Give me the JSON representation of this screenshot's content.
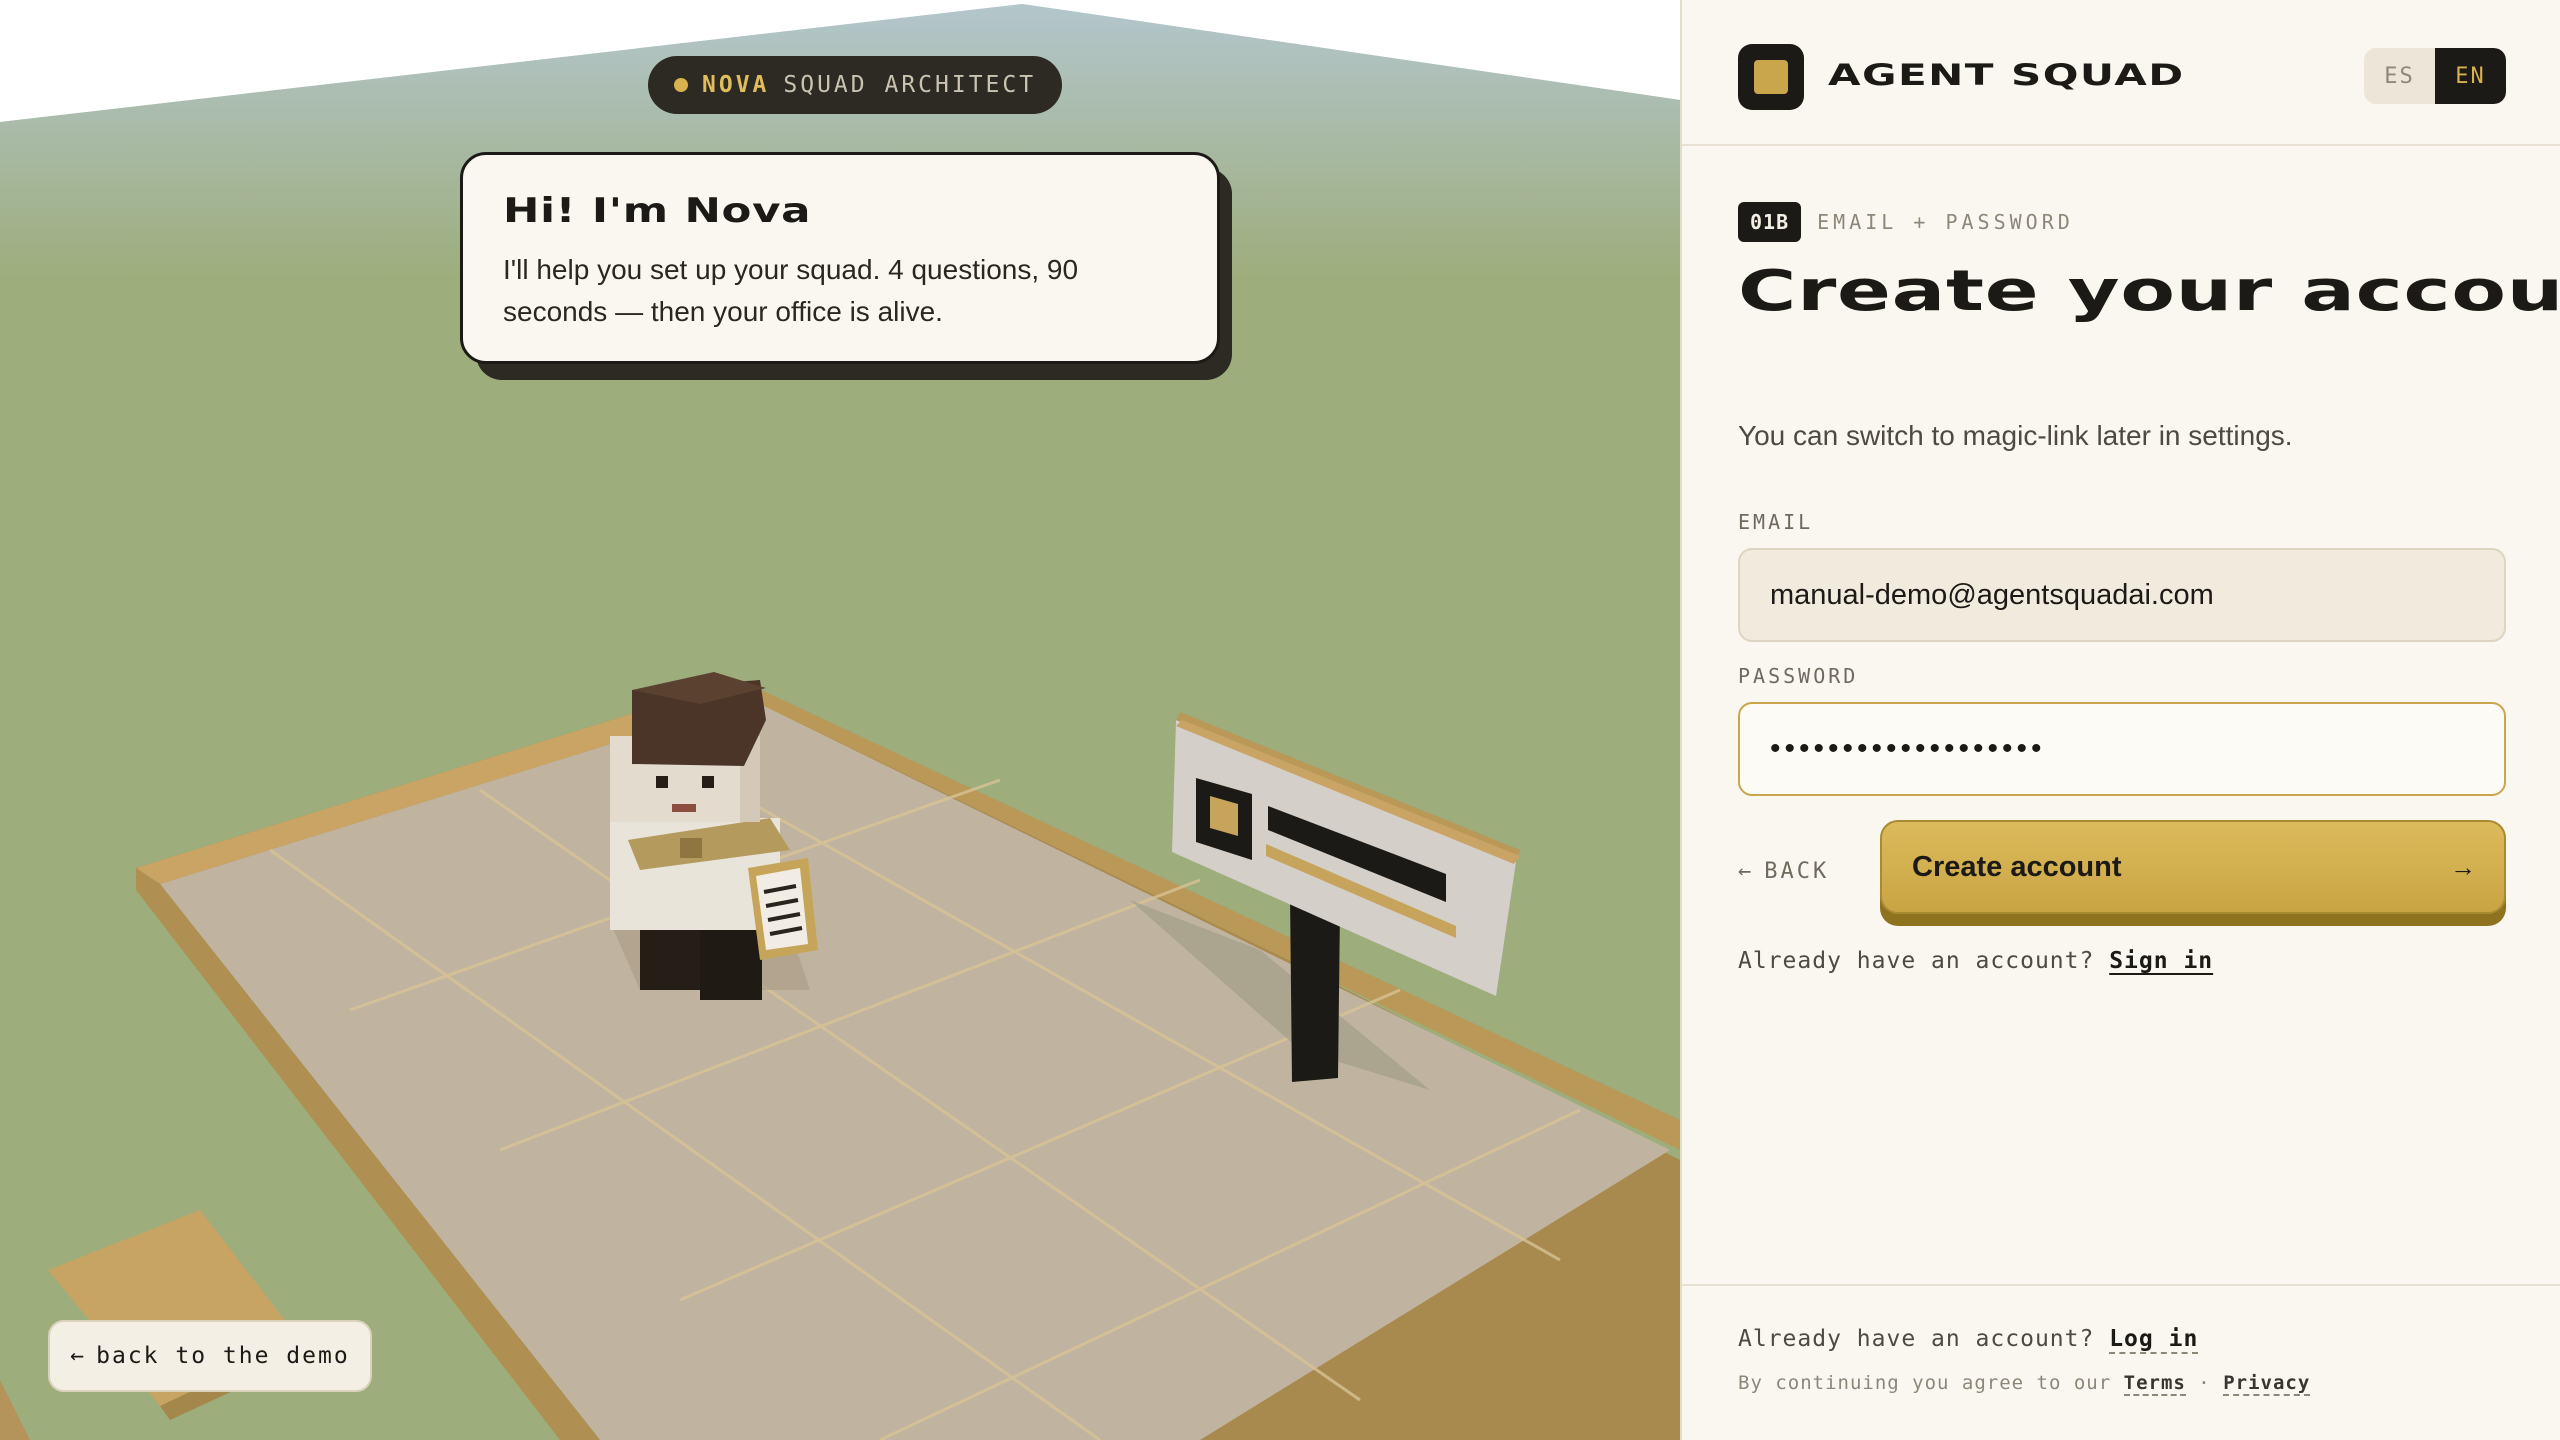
{
  "scene": {
    "badge": {
      "name": "NOVA",
      "role": "SQUAD ARCHITECT"
    },
    "bubble": {
      "title": "Hi! I'm Nova",
      "text": "I'll help you set up your squad. 4 questions, 90 seconds — then your office is alive."
    },
    "back_demo": {
      "arrow": "←",
      "label": "back to the demo"
    }
  },
  "header": {
    "brand": "AGENT SQUAD",
    "lang": {
      "es": "ES",
      "en": "EN",
      "active": "EN"
    }
  },
  "form": {
    "step_number": "01B",
    "step_label": "EMAIL + PASSWORD",
    "title": "Create your account",
    "subtitle": "You can switch to magic-link later in settings.",
    "email_label": "EMAIL",
    "email_value": "manual-demo@agentsquadai.com",
    "password_label": "PASSWORD",
    "password_value": "•••••••••••••••••••",
    "back_arrow": "←",
    "back_label": "BACK",
    "submit_label": "Create account",
    "submit_arrow": "→",
    "already_text": "Already have an account?",
    "sign_in_link": "Sign in"
  },
  "footer": {
    "already_text": "Already have an account?",
    "login_link": "Log in",
    "agree_text": "By continuing you agree to our",
    "terms_link": "Terms",
    "separator": "·",
    "privacy_link": "Privacy"
  },
  "colors": {
    "accent": "#c9a64c",
    "dark": "#1c1a16",
    "panel_bg": "#faf7f0",
    "grass": "#9dad7c"
  }
}
